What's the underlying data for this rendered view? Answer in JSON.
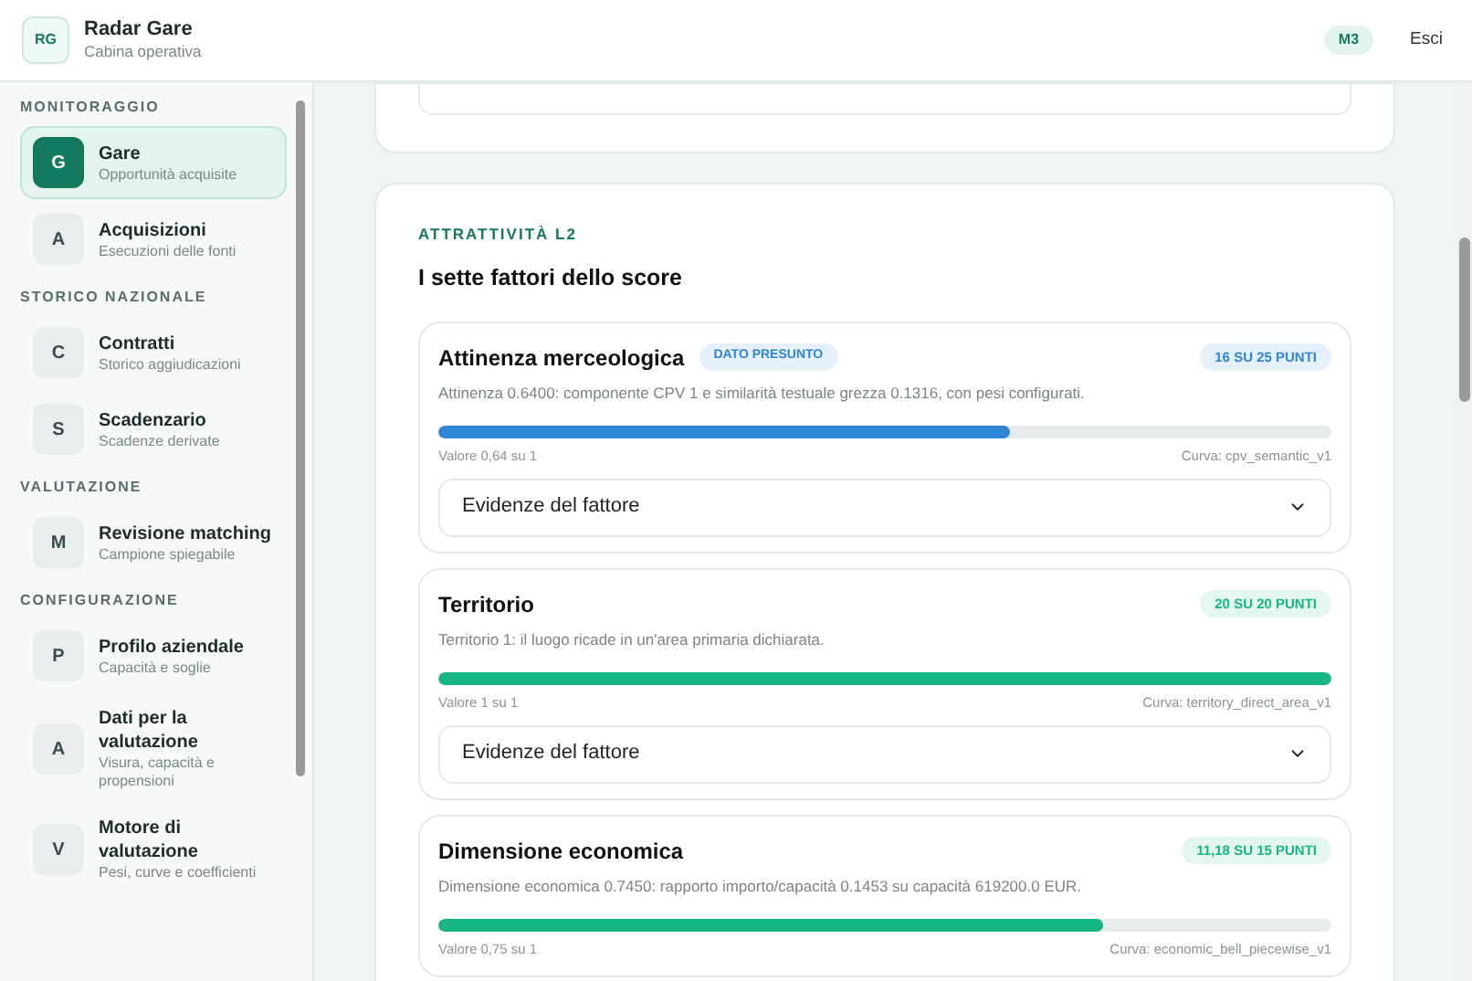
{
  "brand": {
    "initials": "RG",
    "title": "Radar Gare",
    "subtitle": "Cabina operativa"
  },
  "header": {
    "badge": "M3",
    "logout": "Esci"
  },
  "sidebar": {
    "sections": [
      {
        "label": "MONITORAGGIO",
        "items": [
          {
            "letter": "G",
            "title": "Gare",
            "subtitle": "Opportunità acquisite",
            "selected": true
          },
          {
            "letter": "A",
            "title": "Acquisizioni",
            "subtitle": "Esecuzioni delle fonti",
            "selected": false
          }
        ]
      },
      {
        "label": "STORICO NAZIONALE",
        "items": [
          {
            "letter": "C",
            "title": "Contratti",
            "subtitle": "Storico aggiudicazioni",
            "selected": false
          },
          {
            "letter": "S",
            "title": "Scadenzario",
            "subtitle": "Scadenze derivate",
            "selected": false
          }
        ]
      },
      {
        "label": "VALUTAZIONE",
        "items": [
          {
            "letter": "M",
            "title": "Revisione matching",
            "subtitle": "Campione spiegabile",
            "selected": false
          }
        ]
      },
      {
        "label": "CONFIGURAZIONE",
        "items": [
          {
            "letter": "P",
            "title": "Profilo aziendale",
            "subtitle": "Capacità e soglie",
            "selected": false
          },
          {
            "letter": "A",
            "title": "Dati per la valutazione",
            "subtitle": "Visura, capacità e propensioni",
            "selected": false
          },
          {
            "letter": "V",
            "title": "Motore di valutazione",
            "subtitle": "Pesi, curve e coefficienti",
            "selected": false
          }
        ]
      }
    ]
  },
  "section": {
    "eyebrow": "ATTRATTIVITÀ L2",
    "title": "I sette fattori dello score",
    "factors": [
      {
        "name": "Attinenza merceologica",
        "tag": "DATO PRESUNTO",
        "points": "16 SU 25 PUNTI",
        "description": "Attinenza 0.6400: componente CPV 1 e similarità testuale grezza 0.1316, con pesi configurati.",
        "level": 0.64,
        "color": "#2f86d6",
        "value": "Valore 0,64 su 1",
        "curve": "Curva: cpv_semantic_v1",
        "evidence": "Evidenze del fattore"
      },
      {
        "name": "Territorio",
        "points": "20 SU 20 PUNTI",
        "description": "Territorio 1: il luogo ricade in un'area primaria dichiarata.",
        "level": 1,
        "color": "#17b584",
        "value": "Valore 1 su 1",
        "curve": "Curva: territory_direct_area_v1",
        "evidence": "Evidenze del fattore"
      },
      {
        "name": "Dimensione economica",
        "points": "11,18 SU 15 PUNTI",
        "description": "Dimensione economica 0.7450: rapporto importo/capacità 0.1453 su capacità 619200.0 EUR.",
        "level": 0.745,
        "color": "#17b584",
        "value": "Valore 0,75 su 1",
        "curve": "Curva: economic_bell_piecewise_v1"
      }
    ]
  }
}
